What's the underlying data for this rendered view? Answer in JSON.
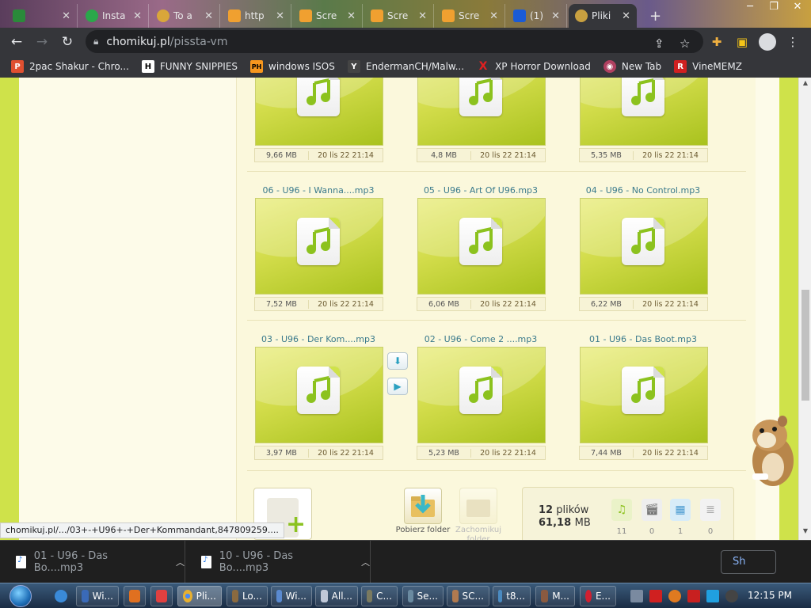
{
  "browser": {
    "tabs": [
      {
        "label": "",
        "color": "#2a8a3a"
      },
      {
        "label": "Insta",
        "color": "#2aa84a"
      },
      {
        "label": "To a",
        "color": "#d9a63a"
      },
      {
        "label": "http",
        "color": "#f0a030"
      },
      {
        "label": "Scre",
        "color": "#f0a030"
      },
      {
        "label": "Scre",
        "color": "#f0a030"
      },
      {
        "label": "Scre",
        "color": "#f0a030"
      },
      {
        "label": "(1)",
        "color": "#1a5bd6"
      },
      {
        "label": "Pliki",
        "color": "#c8a040"
      }
    ],
    "new_tab": "+",
    "url_host": "chomikuj.pl",
    "url_path": "/pissta-vm"
  },
  "bookmarks": [
    {
      "label": "2pac Shakur - Chro...",
      "icon": "P",
      "color": "#e05030"
    },
    {
      "label": "FUNNY SNIPPIES",
      "icon": "H",
      "color": "#ffffff"
    },
    {
      "label": "windows ISOS",
      "icon": "PH",
      "color": "#f7971e"
    },
    {
      "label": "EndermanCH/Malw...",
      "icon": "Y",
      "color": "#444444"
    },
    {
      "label": "XP Horror Download",
      "icon": "X",
      "color": "#e02020"
    },
    {
      "label": "New Tab",
      "icon": "◉",
      "color": "#b04060"
    },
    {
      "label": "VineMEMZ",
      "icon": "R",
      "color": "#d02020"
    }
  ],
  "files": [
    {
      "title": "",
      "size": "9,66 MB",
      "date": "20 lis 22 21:14"
    },
    {
      "title": "",
      "size": "4,8 MB",
      "date": "20 lis 22 21:14"
    },
    {
      "title": "",
      "size": "5,35 MB",
      "date": "20 lis 22 21:14"
    },
    {
      "title": "06 - U96 - I Wanna....mp3",
      "size": "7,52 MB",
      "date": "20 lis 22 21:14"
    },
    {
      "title": "05 - U96 - Art Of U96.mp3",
      "size": "6,06 MB",
      "date": "20 lis 22 21:14"
    },
    {
      "title": "04 - U96 - No Control.mp3",
      "size": "6,22 MB",
      "date": "20 lis 22 21:14"
    },
    {
      "title": "03 - U96 - Der Kom....mp3",
      "size": "3,97 MB",
      "date": "20 lis 22 21:14"
    },
    {
      "title": "02 - U96 - Come 2 ....mp3",
      "size": "5,23 MB",
      "date": "20 lis 22 21:14"
    },
    {
      "title": "01 - U96 - Das Boot.mp3",
      "size": "7,44 MB",
      "date": "20 lis 22 21:14"
    }
  ],
  "actions": {
    "download_folder": "Pobierz folder",
    "save_folder": "Zachomikuj folder"
  },
  "stats": {
    "count": "12",
    "count_label": "plików",
    "size_value": "61,18",
    "size_unit": "MB",
    "types": [
      {
        "icon": "music-icon",
        "count": "11"
      },
      {
        "icon": "video-icon",
        "count": "0"
      },
      {
        "icon": "image-icon",
        "count": "1"
      },
      {
        "icon": "document-icon",
        "count": "0"
      }
    ]
  },
  "status_url": "chomikuj.pl/.../03+-+U96+-+Der+Kommandant,847809259....",
  "downloads": [
    {
      "name": "01 - U96 - Das Bo....mp3"
    },
    {
      "name": "10 - U96 - Das Bo....mp3"
    }
  ],
  "show_all": "Sh",
  "taskbar": {
    "items": [
      {
        "label": "Wi...",
        "color": "#3a6ab8"
      },
      {
        "label": "",
        "color": "#e07020"
      },
      {
        "label": "",
        "color": "#e04040"
      },
      {
        "label": "Pli...",
        "color": "#e8b030"
      },
      {
        "label": "Lo...",
        "color": "#8a6a40"
      },
      {
        "label": "Wi...",
        "color": "#5a8ad0"
      },
      {
        "label": "All...",
        "color": "#c0c8d8"
      },
      {
        "label": "C...",
        "color": "#7a7a60"
      },
      {
        "label": "Se...",
        "color": "#6a8aa0"
      },
      {
        "label": "SC...",
        "color": "#b07a50"
      },
      {
        "label": "t8...",
        "color": "#4a8ac0"
      },
      {
        "label": "M...",
        "color": "#8a5a40"
      },
      {
        "label": "E...",
        "color": "#d02030"
      }
    ],
    "clock": "12:15 PM"
  }
}
